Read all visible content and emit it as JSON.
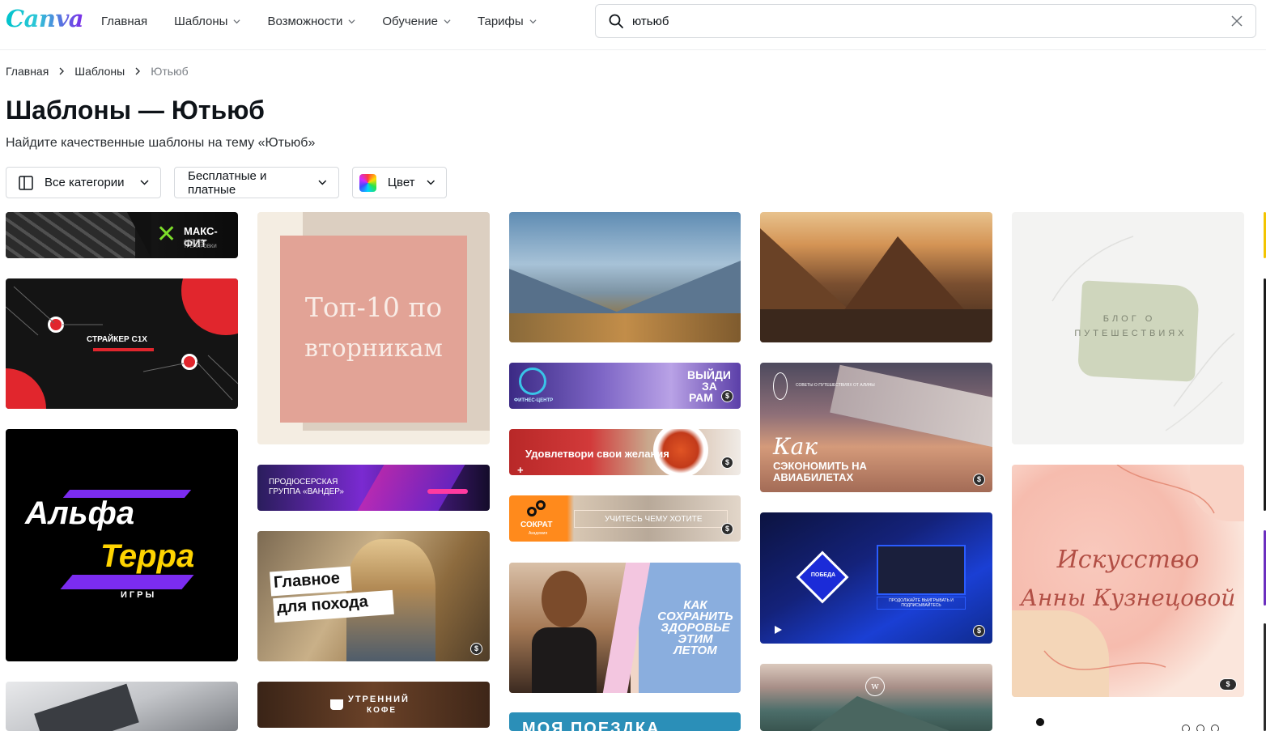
{
  "brand": {
    "logo_text": "Canva"
  },
  "nav": {
    "items": [
      {
        "label": "Главная"
      },
      {
        "label": "Шаблоны"
      },
      {
        "label": "Возможности"
      },
      {
        "label": "Обучение"
      },
      {
        "label": "Тарифы"
      }
    ]
  },
  "search": {
    "value": "ютьюб"
  },
  "breadcrumb": {
    "home": "Главная",
    "templates": "Шаблоны",
    "current": "Ютьюб"
  },
  "page": {
    "title": "Шаблоны — Ютьюб",
    "subtitle": "Найдите качественные шаблоны на тему «Ютьюб»"
  },
  "filters": {
    "categories": "Все категории",
    "pricing": "Бесплатные и платные",
    "color": "Цвет"
  },
  "templates": {
    "maxfit": {
      "title": "МАКС-ФИТ",
      "subtitle": "ФИТНЕС-ТРЕНИРОВКИ"
    },
    "striker": {
      "title": "СТРАЙКЕР С1Х"
    },
    "alfa": {
      "line1": "Альфа",
      "line2": "Терра",
      "tag": "ИГРЫ"
    },
    "top10": {
      "line1": "Топ-10 по",
      "line2": "вторникам"
    },
    "producer": {
      "line1": "ПРОДЮСЕРСКАЯ",
      "line2": "ГРУППА «ВАНДЕР»"
    },
    "hike": {
      "line1": "Главное",
      "line2": "для похода"
    },
    "coffee": {
      "line1": "УТРЕННИЙ",
      "line2": "КОФЕ"
    },
    "fitness": {
      "line1": "ВЫЙДИ",
      "line2": "ЗА",
      "line3": "РАМ",
      "logo": "ФИТНЕС-ЦЕНТР"
    },
    "desires": {
      "title": "Удовлетвори свои желания"
    },
    "sokrat": {
      "logo": "СОКРАТ",
      "sub": "Академия",
      "title": "УЧИТЕСЬ ЧЕМУ ХОТИТЕ"
    },
    "health": {
      "line1": "КАК",
      "line2": "СОХРАНИТЬ",
      "line3": "ЗДОРОВЬЕ",
      "line4": "ЭТИМ",
      "line5": "ЛЕТОМ"
    },
    "trip": {
      "title": "МОЯ ПОЕЗДКА"
    },
    "flights": {
      "small": "СОВЕТЫ О ПУТЕШЕСТВИЯХ ОТ АЛИНЫ",
      "script": "Как",
      "line1": "СЭКОНОМИТЬ НА",
      "line2": "АВИАБИЛЕТАХ"
    },
    "victory": {
      "badge": "ПОБЕДА",
      "sub": "ПРОДОЛЖАЙТЕ ВЫИГРЫВАТЬ И ПОДПИСЫВАЙТЕСЬ"
    },
    "blog": {
      "line1": "БЛОГ О",
      "line2": "ПУТЕШЕСТВИЯХ"
    },
    "art": {
      "line1": "Искусство",
      "line2": "Анны Кузнецовой"
    }
  },
  "premium_badge": "$"
}
